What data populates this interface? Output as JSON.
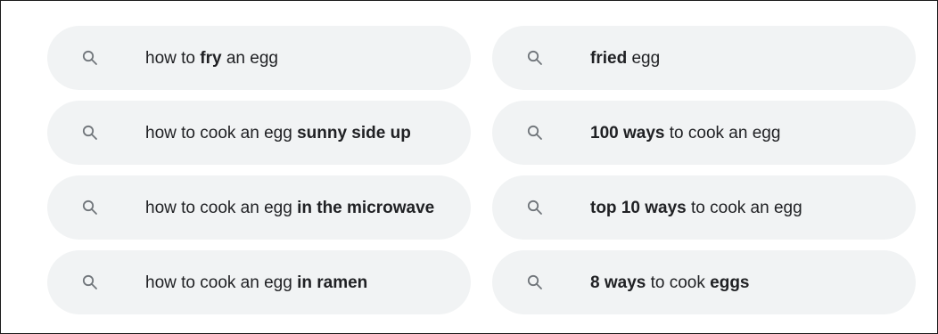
{
  "related_searches": [
    {
      "parts": [
        {
          "text": "how to ",
          "bold": false
        },
        {
          "text": "fry",
          "bold": true
        },
        {
          "text": " an egg",
          "bold": false
        }
      ]
    },
    {
      "parts": [
        {
          "text": "fried",
          "bold": true
        },
        {
          "text": " egg",
          "bold": false
        }
      ]
    },
    {
      "parts": [
        {
          "text": "how to cook an egg ",
          "bold": false
        },
        {
          "text": "sunny side up",
          "bold": true
        }
      ]
    },
    {
      "parts": [
        {
          "text": "100 ways",
          "bold": true
        },
        {
          "text": " to cook an egg",
          "bold": false
        }
      ]
    },
    {
      "parts": [
        {
          "text": "how to cook an egg ",
          "bold": false
        },
        {
          "text": "in the microwave",
          "bold": true
        }
      ]
    },
    {
      "parts": [
        {
          "text": "top 10 ways",
          "bold": true
        },
        {
          "text": " to cook an egg",
          "bold": false
        }
      ]
    },
    {
      "parts": [
        {
          "text": "how to cook an egg ",
          "bold": false
        },
        {
          "text": "in ramen",
          "bold": true
        }
      ]
    },
    {
      "parts": [
        {
          "text": "8 ways",
          "bold": true
        },
        {
          "text": " to cook ",
          "bold": false
        },
        {
          "text": "eggs",
          "bold": true
        }
      ]
    }
  ],
  "icon": "search-icon",
  "colors": {
    "chip_bg": "#f1f3f4",
    "text": "#202124",
    "icon": "#70757a"
  }
}
